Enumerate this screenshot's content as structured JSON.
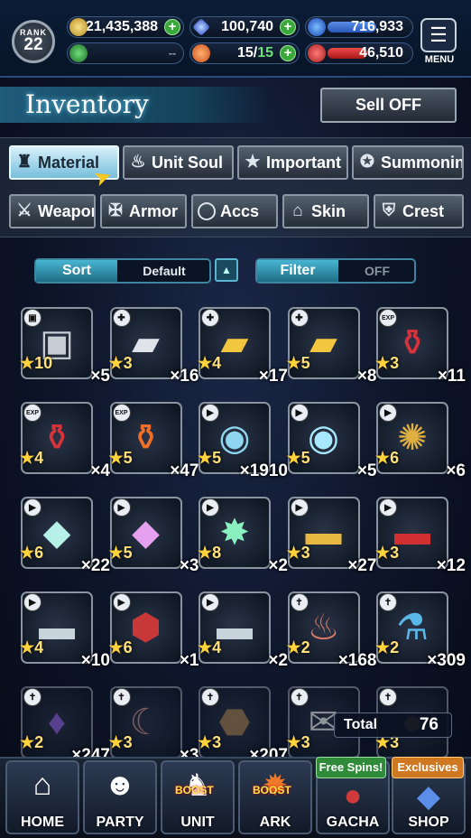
{
  "header": {
    "rank_label": "RANK",
    "rank_value": "22",
    "gil": "21,435,388",
    "lapis": "100,740",
    "blue_stat": "716,933",
    "green_stat": "--",
    "stamina": "15/",
    "stamina_max": "15",
    "red_stat": "46,510",
    "menu_label": "MENU"
  },
  "title": "Inventory",
  "sell_label": "Sell OFF",
  "tabs_row1": [
    {
      "label": "Material",
      "icon": "bag-icon"
    },
    {
      "label": "Unit Soul",
      "icon": "flame-icon"
    },
    {
      "label": "Important",
      "icon": "star-icon"
    },
    {
      "label": "Summoning",
      "icon": "summon-icon"
    }
  ],
  "tabs_row2": [
    {
      "label": "Weapon",
      "icon": "sword-icon"
    },
    {
      "label": "Armor",
      "icon": "armor-icon"
    },
    {
      "label": "Accs",
      "icon": "ring-icon"
    },
    {
      "label": "Skin",
      "icon": "hanger-icon"
    },
    {
      "label": "Crest",
      "icon": "crest-icon"
    }
  ],
  "sort": {
    "label": "Sort",
    "value": "Default"
  },
  "filter": {
    "label": "Filter",
    "value": "OFF"
  },
  "items": [
    {
      "rarity": "10",
      "qty": "×5",
      "icon": "chest-icon",
      "tag": "box"
    },
    {
      "rarity": "3",
      "qty": "×16",
      "icon": "silver-ingot-icon",
      "tag": "+"
    },
    {
      "rarity": "4",
      "qty": "×17",
      "icon": "gold-ingot-icon",
      "tag": "+"
    },
    {
      "rarity": "5",
      "qty": "×8",
      "icon": "gold-stack-icon",
      "tag": "+"
    },
    {
      "rarity": "3",
      "qty": "×11",
      "icon": "potion-icon",
      "tag": "EXP"
    },
    {
      "rarity": "4",
      "qty": "×4",
      "icon": "potion-icon",
      "tag": "EXP"
    },
    {
      "rarity": "5",
      "qty": "×47",
      "icon": "fire-flask-icon",
      "tag": "EXP"
    },
    {
      "rarity": "5",
      "qty": "×1910",
      "icon": "crystal-orb-icon",
      "tag": "SR"
    },
    {
      "rarity": "5",
      "qty": "×5",
      "icon": "gem-orb-icon",
      "tag": "SR"
    },
    {
      "rarity": "6",
      "qty": "×6",
      "icon": "golden-relic-icon",
      "tag": "SR"
    },
    {
      "rarity": "6",
      "qty": "×22",
      "icon": "prism-crystal-icon",
      "tag": "SR"
    },
    {
      "rarity": "5",
      "qty": "×3",
      "icon": "rainbow-crystal-icon",
      "tag": "SR"
    },
    {
      "rarity": "8",
      "qty": "×2",
      "icon": "burst-crystal-icon",
      "tag": "SR"
    },
    {
      "rarity": "3",
      "qty": "×27",
      "icon": "gold-ticket-icon",
      "tag": "SR"
    },
    {
      "rarity": "3",
      "qty": "×12",
      "icon": "red-ticket-icon",
      "tag": "SR"
    },
    {
      "rarity": "4",
      "qty": "×10",
      "icon": "silver-ticket-icon",
      "tag": "SR"
    },
    {
      "rarity": "6",
      "qty": "×1",
      "icon": "red-stone-icon",
      "tag": "SR"
    },
    {
      "rarity": "4",
      "qty": "×2",
      "icon": "timed-ticket-icon",
      "tag": "SR"
    },
    {
      "rarity": "2",
      "qty": "×168",
      "icon": "meat-icon",
      "tag": "sword"
    },
    {
      "rarity": "2",
      "qty": "×309",
      "icon": "water-bottle-icon",
      "tag": "sword"
    },
    {
      "rarity": "2",
      "qty": "×247",
      "icon": "purple-crystal-icon",
      "tag": "sword"
    },
    {
      "rarity": "3",
      "qty": "×3",
      "icon": "horn-icon",
      "tag": "sword"
    },
    {
      "rarity": "3",
      "qty": "×207",
      "icon": "ore-icon",
      "tag": "sword"
    },
    {
      "rarity": "3",
      "qty": "",
      "icon": "letter-icon",
      "tag": "sword"
    },
    {
      "rarity": "3",
      "qty": "",
      "icon": "fruit-icon",
      "tag": "sword"
    }
  ],
  "total": {
    "label": "Total",
    "value": "76"
  },
  "nav": [
    {
      "label": "HOME",
      "icon": "home-icon"
    },
    {
      "label": "PARTY",
      "icon": "party-icon"
    },
    {
      "label": "UNIT",
      "icon": "unit-icon",
      "boost": "BOOST"
    },
    {
      "label": "ARK",
      "icon": "ark-icon",
      "boost": "BOOST"
    },
    {
      "label": "GACHA",
      "icon": "gacha-icon"
    },
    {
      "label": "SHOP",
      "icon": "shop-icon"
    }
  ],
  "free_spins": "Free Spins!",
  "exclusives": "Exclusives",
  "colors": {
    "accent": "#49b5d2",
    "gold": "#ffd23c",
    "plus": "#3ca83c"
  }
}
